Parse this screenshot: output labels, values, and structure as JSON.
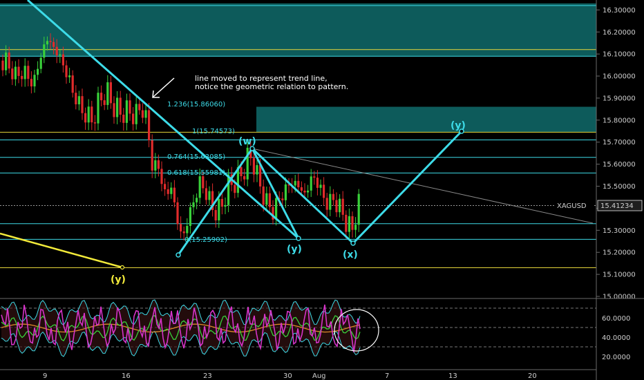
{
  "chart_data": {
    "type": "candlestick",
    "symbol": "XAGUSD",
    "last_price": "15.41234",
    "ylim": [
      15.0,
      16.32
    ],
    "y_ticks": [
      "16.30000",
      "16.20000",
      "16.10000",
      "16.00000",
      "15.90000",
      "15.80000",
      "15.70000",
      "15.60000",
      "15.50000",
      "15.40000",
      "15.30000",
      "15.20000",
      "15.10000",
      "15.00000"
    ],
    "x_ticks": [
      "9",
      "16",
      "23",
      "30",
      "Aug",
      "7",
      "13",
      "20"
    ],
    "annotation": [
      "line moved to represent trend line,",
      "notice the geometric relation to pattern."
    ],
    "fib_labels": [
      {
        "text": "1.236(15.86060)",
        "value": 15.8606
      },
      {
        "text": "1(15.74573)",
        "value": 15.74573
      },
      {
        "text": "0.764(15.63085)",
        "value": 15.63085
      },
      {
        "text": "0.618(15.55981)",
        "value": 15.55981
      },
      {
        "text": "0(15.25902)",
        "value": 15.25902
      }
    ],
    "horizontal_levels": {
      "cyan": [
        16.32,
        16.09,
        15.71,
        15.631,
        15.56,
        15.33,
        15.259
      ],
      "yellow": [
        16.12,
        15.745,
        15.13
      ],
      "gray": [
        15.41234
      ]
    },
    "zones": [
      {
        "from": 16.09,
        "to": 16.33
      },
      {
        "from": 15.745,
        "to": 15.8606
      }
    ],
    "wave_labels": [
      {
        "text": "(w)",
        "color": "cyan",
        "date": 26.2,
        "value": 15.69
      },
      {
        "text": "(y)",
        "color": "cyan",
        "date": 31.3,
        "value": 15.225
      },
      {
        "text": "(x)",
        "color": "cyan",
        "date": 34.2,
        "value": 15.21
      },
      {
        "text": "(y)",
        "color": "cyan",
        "date": 42.2,
        "value": 15.775
      },
      {
        "text": "(y)",
        "color": "yellow",
        "date": 13.5,
        "value": 15.085
      }
    ],
    "rsi": {
      "ylim": [
        10,
        80
      ],
      "ticks": [
        "60.0000",
        "40.0000",
        "20.0000"
      ],
      "levels": [
        70,
        50,
        30
      ]
    }
  }
}
